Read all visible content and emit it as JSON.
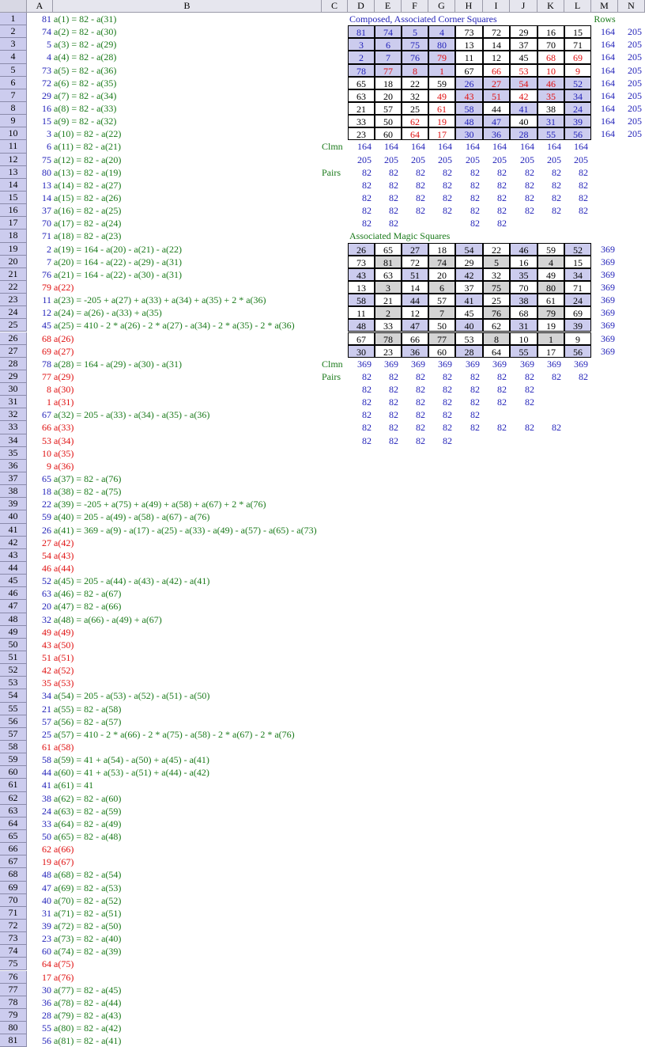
{
  "columns": [
    "A",
    "B",
    "C",
    "D",
    "E",
    "F",
    "G",
    "H",
    "I",
    "J",
    "K",
    "L",
    "M",
    "N"
  ],
  "colB": [
    [
      "81",
      "a(1) = 82 - a(31)",
      "b"
    ],
    [
      "74",
      "a(2) = 82 - a(30)",
      "b"
    ],
    [
      "5",
      "a(3) = 82 - a(29)",
      "b"
    ],
    [
      "4",
      "a(4) = 82 - a(28)",
      "b"
    ],
    [
      "73",
      "a(5) = 82 - a(36)",
      "b"
    ],
    [
      "72",
      "a(6) = 82 - a(35)",
      "b"
    ],
    [
      "29",
      "a(7) = 82 - a(34)",
      "b"
    ],
    [
      "16",
      "a(8) = 82 - a(33)",
      "b"
    ],
    [
      "15",
      "a(9) = 82 - a(32)",
      "b"
    ],
    [
      "3",
      "a(10) = 82 - a(22)",
      "b"
    ],
    [
      "6",
      "a(11) = 82 - a(21)",
      "b"
    ],
    [
      "75",
      "a(12) = 82 - a(20)",
      "b"
    ],
    [
      "80",
      "a(13) = 82 - a(19)",
      "b"
    ],
    [
      "13",
      "a(14) = 82 - a(27)",
      "b"
    ],
    [
      "14",
      "a(15) = 82 - a(26)",
      "b"
    ],
    [
      "37",
      "a(16) = 82 - a(25)",
      "b"
    ],
    [
      "70",
      "a(17) = 82 - a(24)",
      "b"
    ],
    [
      "71",
      "a(18) = 82 - a(23)",
      "b"
    ],
    [
      "2",
      "a(19) = 164 - a(20) - a(21) - a(22)",
      "b"
    ],
    [
      "7",
      "a(20) = 164 - a(22) - a(29) - a(31)",
      "b"
    ],
    [
      "76",
      "a(21) = 164 - a(22) - a(30) - a(31)",
      "b"
    ],
    [
      "79",
      "a(22)",
      "r"
    ],
    [
      "11",
      "a(23) = -205 + a(27) + a(33) + a(34) + a(35) + 2 * a(36)",
      "b"
    ],
    [
      "12",
      "a(24) = a(26) - a(33) + a(35)",
      "b"
    ],
    [
      "45",
      "a(25) = 410 - 2 * a(26) - 2 * a(27) - a(34) - 2 * a(35) - 2 * a(36)",
      "b"
    ],
    [
      "68",
      "a(26)",
      "r"
    ],
    [
      "69",
      "a(27)",
      "r"
    ],
    [
      "78",
      "a(28) = 164 - a(29) - a(30) - a(31)",
      "b"
    ],
    [
      "77",
      "a(29)",
      "r"
    ],
    [
      "8",
      "a(30)",
      "r"
    ],
    [
      "1",
      "a(31)",
      "r"
    ],
    [
      "67",
      "a(32) = 205 - a(33) - a(34) - a(35) - a(36)",
      "b"
    ],
    [
      "66",
      "a(33)",
      "r"
    ],
    [
      "53",
      "a(34)",
      "r"
    ],
    [
      "10",
      "a(35)",
      "r"
    ],
    [
      "9",
      "a(36)",
      "r"
    ],
    [
      "65",
      "a(37) = 82 - a(76)",
      "b"
    ],
    [
      "18",
      "a(38) = 82 - a(75)",
      "b"
    ],
    [
      "22",
      "a(39) = -205 + a(75) + a(49) + a(58) + a(67) + 2 * a(76)",
      "b"
    ],
    [
      "59",
      "a(40) = 205 - a(49) - a(58) - a(67) - a(76)",
      "b"
    ],
    [
      "26",
      "a(41) = 369 - a(9) - a(17) - a(25) - a(33) - a(49) - a(57) - a(65) - a(73)",
      "b"
    ],
    [
      "27",
      "a(42)",
      "r"
    ],
    [
      "54",
      "a(43)",
      "r"
    ],
    [
      "46",
      "a(44)",
      "r"
    ],
    [
      "52",
      "a(45) = 205 - a(44) - a(43) - a(42) - a(41)",
      "b"
    ],
    [
      "63",
      "a(46) = 82 - a(67)",
      "b"
    ],
    [
      "20",
      "a(47) = 82 - a(66)",
      "b"
    ],
    [
      "32",
      "a(48) = a(66) - a(49) + a(67)",
      "b"
    ],
    [
      "49",
      "a(49)",
      "r"
    ],
    [
      "43",
      "a(50)",
      "r"
    ],
    [
      "51",
      "a(51)",
      "r"
    ],
    [
      "42",
      "a(52)",
      "r"
    ],
    [
      "35",
      "a(53)",
      "r"
    ],
    [
      "34",
      "a(54) = 205 - a(53) - a(52) - a(51) - a(50)",
      "b"
    ],
    [
      "21",
      "a(55) = 82 - a(58)",
      "b"
    ],
    [
      "57",
      "a(56) = 82 - a(57)",
      "b"
    ],
    [
      "25",
      "a(57) = 410 - 2 * a(66) - 2 * a(75) - a(58) - 2 * a(67) - 2 * a(76)",
      "b"
    ],
    [
      "61",
      "a(58)",
      "r"
    ],
    [
      "58",
      "a(59) = 41 + a(54) - a(50) + a(45) - a(41)",
      "b"
    ],
    [
      "44",
      "a(60) = 41 + a(53) - a(51) + a(44) - a(42)",
      "b"
    ],
    [
      "41",
      "a(61) = 41",
      "b"
    ],
    [
      "38",
      "a(62) = 82 - a(60)",
      "b"
    ],
    [
      "24",
      "a(63) = 82 - a(59)",
      "b"
    ],
    [
      "33",
      "a(64) = 82 - a(49)",
      "b"
    ],
    [
      "50",
      "a(65) = 82 - a(48)",
      "b"
    ],
    [
      "62",
      "a(66)",
      "r"
    ],
    [
      "19",
      "a(67)",
      "r"
    ],
    [
      "48",
      "a(68) = 82 - a(54)",
      "b"
    ],
    [
      "47",
      "a(69) = 82 - a(53)",
      "b"
    ],
    [
      "40",
      "a(70) = 82 - a(52)",
      "b"
    ],
    [
      "31",
      "a(71) = 82 - a(51)",
      "b"
    ],
    [
      "39",
      "a(72) = 82 - a(50)",
      "b"
    ],
    [
      "23",
      "a(73) = 82 - a(40)",
      "b"
    ],
    [
      "60",
      "a(74) = 82 - a(39)",
      "b"
    ],
    [
      "64",
      "a(75)",
      "r"
    ],
    [
      "17",
      "a(76)",
      "r"
    ],
    [
      "30",
      "a(77) = 82 - a(45)",
      "b"
    ],
    [
      "36",
      "a(78) = 82 - a(44)",
      "b"
    ],
    [
      "28",
      "a(79) = 82 - a(43)",
      "b"
    ],
    [
      "55",
      "a(80) = 82 - a(42)",
      "b"
    ],
    [
      "56",
      "a(81) = 82 - a(41)",
      "b"
    ]
  ],
  "titles": {
    "composed": "Composed, Associated Corner Squares",
    "rows": "Rows",
    "clmn": "Clmn",
    "pairs": "Pairs",
    "associated": "Associated Magic Squares"
  },
  "sq1": [
    [
      "81",
      "74",
      "5",
      "4",
      "73",
      "72",
      "29",
      "16",
      "15"
    ],
    [
      "3",
      "6",
      "75",
      "80",
      "13",
      "14",
      "37",
      "70",
      "71"
    ],
    [
      "2",
      "7",
      "76",
      "79",
      "11",
      "12",
      "45",
      "68",
      "69"
    ],
    [
      "78",
      "77",
      "8",
      "1",
      "67",
      "66",
      "53",
      "10",
      "9"
    ],
    [
      "65",
      "18",
      "22",
      "59",
      "26",
      "27",
      "54",
      "46",
      "52"
    ],
    [
      "63",
      "20",
      "32",
      "49",
      "43",
      "51",
      "42",
      "35",
      "34"
    ],
    [
      "21",
      "57",
      "25",
      "61",
      "58",
      "44",
      "41",
      "38",
      "24"
    ],
    [
      "33",
      "50",
      "62",
      "19",
      "48",
      "47",
      "40",
      "31",
      "39"
    ],
    [
      "23",
      "60",
      "64",
      "17",
      "30",
      "36",
      "28",
      "55",
      "56"
    ]
  ],
  "sq1_rows": [
    [
      "164",
      "205"
    ],
    [
      "164",
      "205"
    ],
    [
      "164",
      "205"
    ],
    [
      "164",
      "205"
    ],
    [
      "164",
      "205"
    ],
    [
      "164",
      "205"
    ],
    [
      "164",
      "205"
    ],
    [
      "164",
      "205"
    ],
    [
      "164",
      "205"
    ]
  ],
  "sq1_clmn": [
    [
      "164",
      "164",
      "164",
      "164",
      "164",
      "164",
      "164",
      "164",
      "164"
    ],
    [
      "205",
      "205",
      "205",
      "205",
      "205",
      "205",
      "205",
      "205",
      "205"
    ]
  ],
  "sq1_pairs": [
    [
      "82",
      "82",
      "82",
      "82",
      "82",
      "82",
      "82",
      "82",
      "82"
    ],
    [
      "82",
      "82",
      "82",
      "82",
      "82",
      "82",
      "82",
      "82",
      "82"
    ],
    [
      "82",
      "82",
      "82",
      "82",
      "82",
      "82",
      "82",
      "82",
      "82"
    ],
    [
      "82",
      "82",
      "82",
      "82",
      "82",
      "82",
      "82",
      "82",
      "82"
    ],
    [
      "82",
      "82",
      "",
      "",
      "82",
      "82",
      "",
      "",
      ""
    ]
  ],
  "sq2": [
    [
      "26",
      "65",
      "27",
      "18",
      "54",
      "22",
      "46",
      "59",
      "52"
    ],
    [
      "73",
      "81",
      "72",
      "74",
      "29",
      "5",
      "16",
      "4",
      "15"
    ],
    [
      "43",
      "63",
      "51",
      "20",
      "42",
      "32",
      "35",
      "49",
      "34"
    ],
    [
      "13",
      "3",
      "14",
      "6",
      "37",
      "75",
      "70",
      "80",
      "71"
    ],
    [
      "58",
      "21",
      "44",
      "57",
      "41",
      "25",
      "38",
      "61",
      "24"
    ],
    [
      "11",
      "2",
      "12",
      "7",
      "45",
      "76",
      "68",
      "79",
      "69"
    ],
    [
      "48",
      "33",
      "47",
      "50",
      "40",
      "62",
      "31",
      "19",
      "39"
    ],
    [
      "67",
      "78",
      "66",
      "77",
      "53",
      "8",
      "10",
      "1",
      "9"
    ],
    [
      "30",
      "23",
      "36",
      "60",
      "28",
      "64",
      "55",
      "17",
      "56"
    ]
  ],
  "sq2_rows": [
    "369",
    "369",
    "369",
    "369",
    "369",
    "369",
    "369",
    "369",
    "369"
  ],
  "sq2_clmn": [
    "369",
    "369",
    "369",
    "369",
    "369",
    "369",
    "369",
    "369",
    "369"
  ],
  "sq2_pairs": [
    [
      "82",
      "82",
      "82",
      "82",
      "82",
      "82",
      "82",
      "82",
      "82"
    ],
    [
      "82",
      "82",
      "82",
      "82",
      "82",
      "82",
      "82",
      "",
      ""
    ],
    [
      "82",
      "82",
      "82",
      "82",
      "82",
      "82",
      "82",
      "",
      ""
    ],
    [
      "82",
      "82",
      "82",
      "82",
      "82",
      "",
      "",
      "",
      ""
    ],
    [
      "82",
      "82",
      "82",
      "82",
      "82",
      "82",
      "82",
      "82",
      ""
    ],
    [
      "82",
      "82",
      "82",
      "82",
      "",
      "",
      "",
      "",
      ""
    ]
  ],
  "colors": {
    "blue": "#1f1fb8",
    "red": "#e01010",
    "green": "#1a7a1a",
    "highlight": "#ccccee",
    "gray": "#d4d4d4"
  }
}
